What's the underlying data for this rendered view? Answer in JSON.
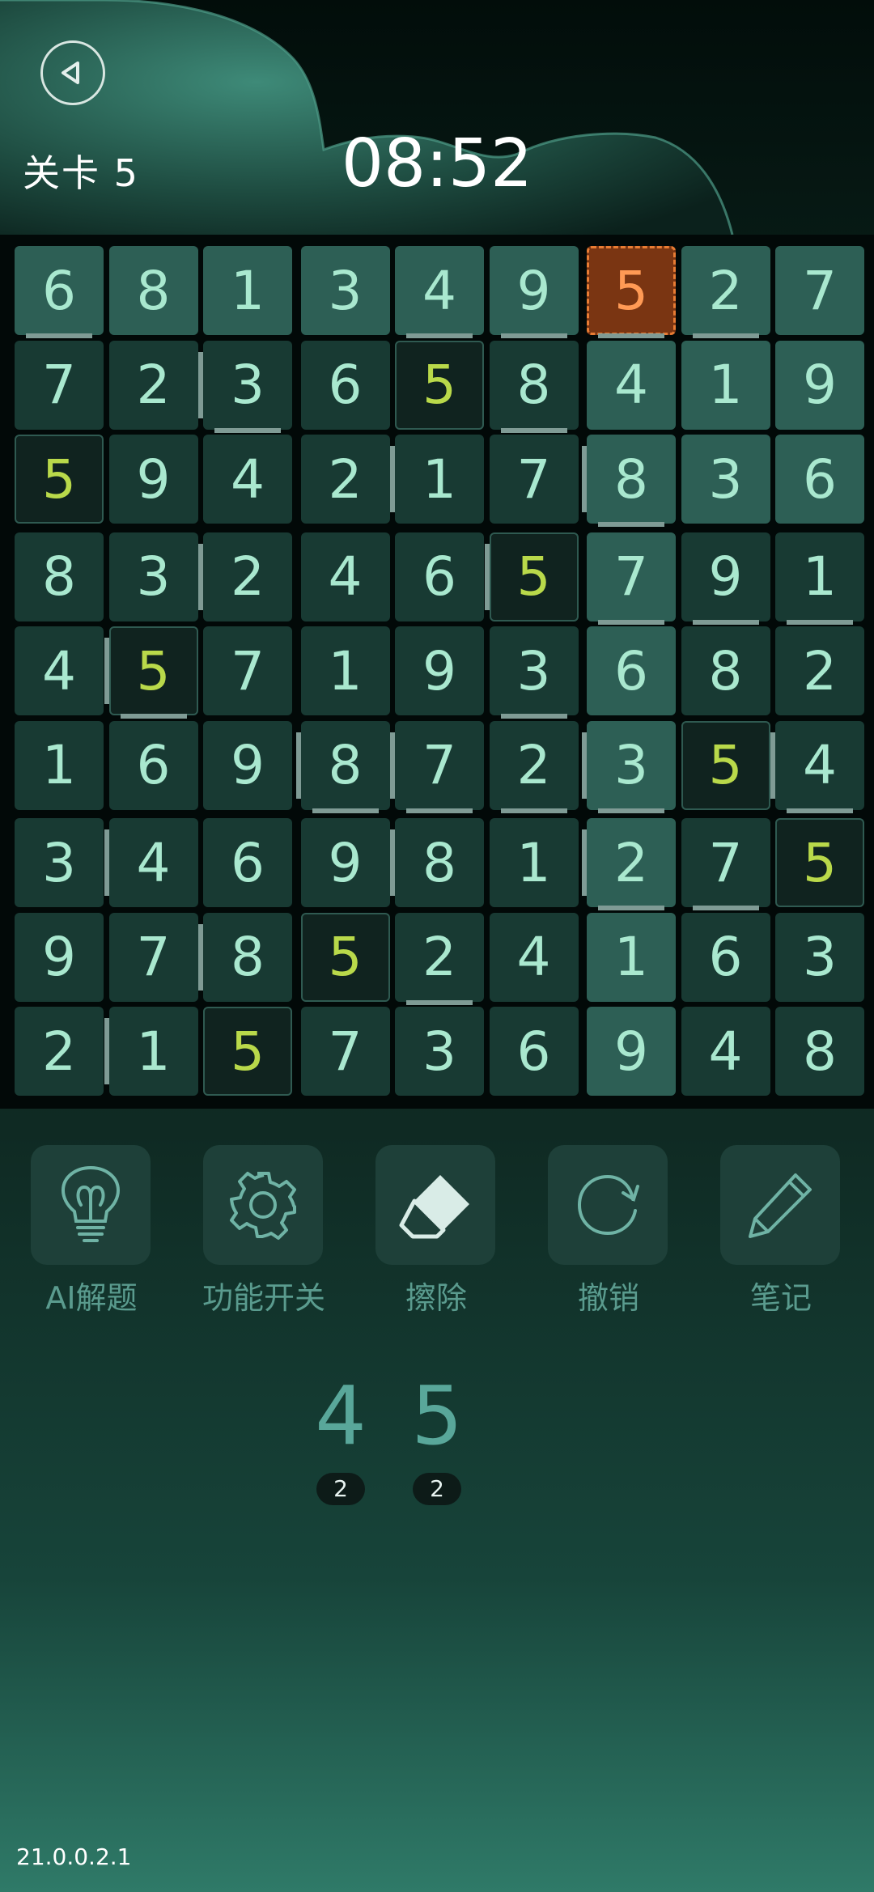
{
  "header": {
    "level_label": "关卡 5",
    "timer": "08:52"
  },
  "board": {
    "values": [
      [
        6,
        8,
        1,
        3,
        4,
        9,
        5,
        2,
        7
      ],
      [
        7,
        2,
        3,
        6,
        5,
        8,
        4,
        1,
        9
      ],
      [
        5,
        9,
        4,
        2,
        1,
        7,
        8,
        3,
        6
      ],
      [
        8,
        3,
        2,
        4,
        6,
        5,
        7,
        9,
        1
      ],
      [
        4,
        5,
        7,
        1,
        9,
        3,
        6,
        8,
        2
      ],
      [
        1,
        6,
        9,
        8,
        7,
        2,
        3,
        5,
        4
      ],
      [
        3,
        4,
        6,
        9,
        8,
        1,
        2,
        7,
        5
      ],
      [
        9,
        7,
        8,
        5,
        2,
        4,
        1,
        6,
        3
      ],
      [
        2,
        1,
        5,
        7,
        3,
        6,
        9,
        4,
        8
      ]
    ],
    "selected_cell": [
      0,
      6
    ],
    "selected_value": 5,
    "colors": {
      "number": "#a9e8cf",
      "highlight_number": "#b9d94a",
      "selected_number": "#ff9a55",
      "selected_bg": "#7a3512",
      "selected_border": "#e87c34"
    }
  },
  "toolbar": {
    "items": [
      {
        "label": "AI解题",
        "icon": "lightbulb-icon"
      },
      {
        "label": "功能开关",
        "icon": "gear-icon"
      },
      {
        "label": "擦除",
        "icon": "eraser-icon"
      },
      {
        "label": "撤销",
        "icon": "undo-icon"
      },
      {
        "label": "笔记",
        "icon": "pencil-icon"
      }
    ]
  },
  "number_pad": [
    {
      "number": "4",
      "remaining": "2"
    },
    {
      "number": "5",
      "remaining": "2"
    }
  ],
  "version": "21.0.0.2.1"
}
